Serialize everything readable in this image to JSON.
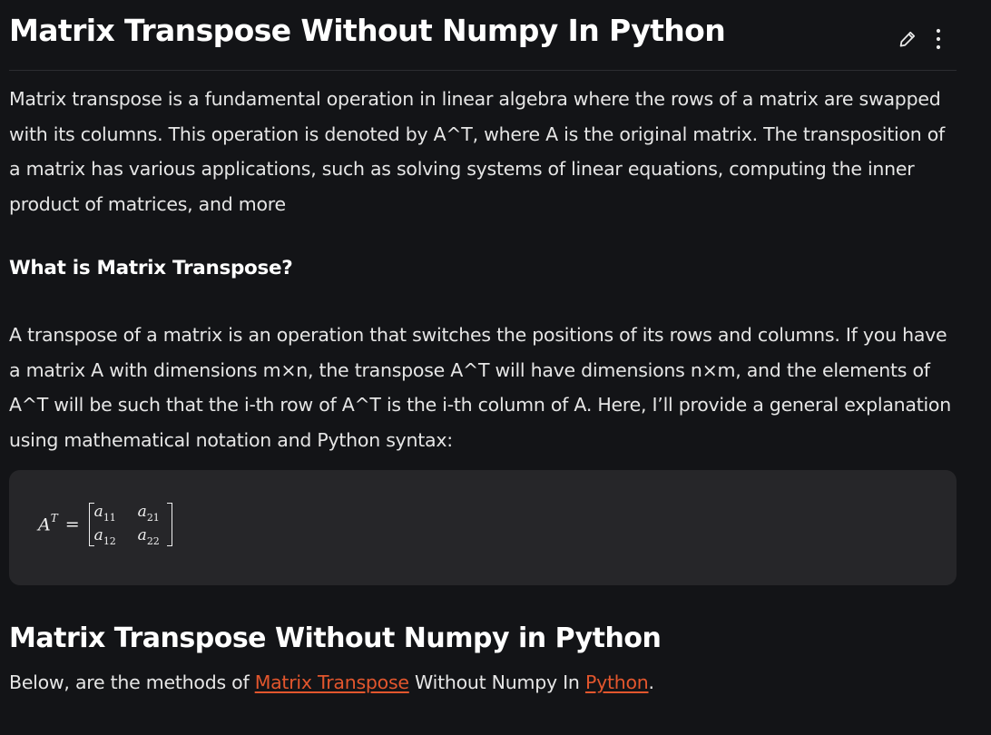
{
  "header": {
    "title": "Matrix Transpose Without Numpy In Python",
    "actions": [
      {
        "icon": "pencil-icon",
        "glyph": "✎"
      },
      {
        "icon": "more-vertical-icon",
        "glyph": "⋮"
      }
    ]
  },
  "intro": {
    "text": "Matrix transpose is a fundamental operation in linear algebra where the rows of a matrix are swapped with its columns. This operation is denoted by A^T, where A is the original matrix. The transposition of a matrix has various applications, such as solving systems of linear equations, computing the inner product of matrices, and more"
  },
  "section1": {
    "heading": "What is Matrix Transpose?",
    "text": "A transpose of a matrix is an operation that switches the positions of its rows and columns. If you have a matrix A with dimensions m×n, the transpose A^T will have dimensions n×m, and the elements of A^T will be such that the i-th row of A^T is the i-th column of A. Here, I’ll provide a general explanation using mathematical notation and Python syntax:"
  },
  "math": {
    "lhs_base": "A",
    "lhs_sup": "T",
    "equals": "=",
    "cells": [
      {
        "base": "a",
        "sub": "11"
      },
      {
        "base": "a",
        "sub": "21"
      },
      {
        "base": "a",
        "sub": "12"
      },
      {
        "base": "a",
        "sub": "22"
      }
    ]
  },
  "section2": {
    "heading": "Matrix Transpose Without Numpy in Python",
    "line_prefix": "Below, are the methods of ",
    "link1": "Matrix Transpose",
    "line_middle": " Without Numpy In ",
    "link2": "Python",
    "line_suffix": "."
  },
  "colors": {
    "background": "#131417",
    "code_block": "#262629",
    "link": "#e2562d",
    "text": "#e6e6e6"
  }
}
